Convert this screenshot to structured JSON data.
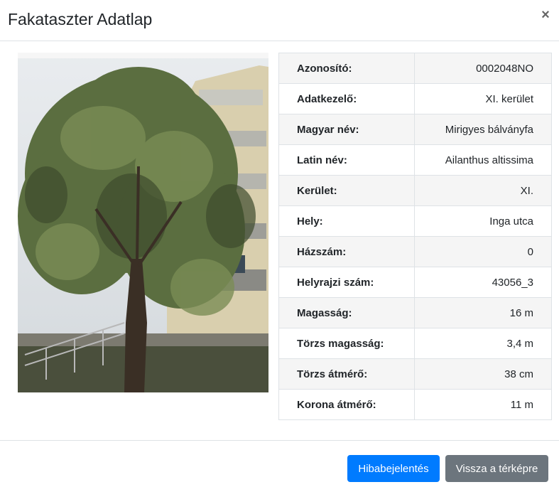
{
  "modal": {
    "title": "Fakataszter Adatlap",
    "close_label": "×"
  },
  "photo": {
    "description_icon": "tree-photo"
  },
  "details": [
    {
      "key": "Azonosító:",
      "value": "0002048NO"
    },
    {
      "key": "Adatkezelő:",
      "value": "XI. kerület"
    },
    {
      "key": "Magyar név:",
      "value": "Mirigyes bálványfa"
    },
    {
      "key": "Latin név:",
      "value": "Ailanthus altissima"
    },
    {
      "key": "Kerület:",
      "value": "XI."
    },
    {
      "key": "Hely:",
      "value": "Inga utca"
    },
    {
      "key": "Házszám:",
      "value": "0"
    },
    {
      "key": "Helyrajzi szám:",
      "value": "43056_3"
    },
    {
      "key": "Magasság:",
      "value": "16 m"
    },
    {
      "key": "Törzs magasság:",
      "value": "3,4 m"
    },
    {
      "key": "Törzs átmérő:",
      "value": "38 cm"
    },
    {
      "key": "Korona átmérő:",
      "value": "11 m"
    }
  ],
  "footer": {
    "report_label": "Hibabejelentés",
    "back_label": "Vissza a térképre"
  },
  "colors": {
    "primary": "#007bff",
    "secondary": "#6c757d"
  }
}
